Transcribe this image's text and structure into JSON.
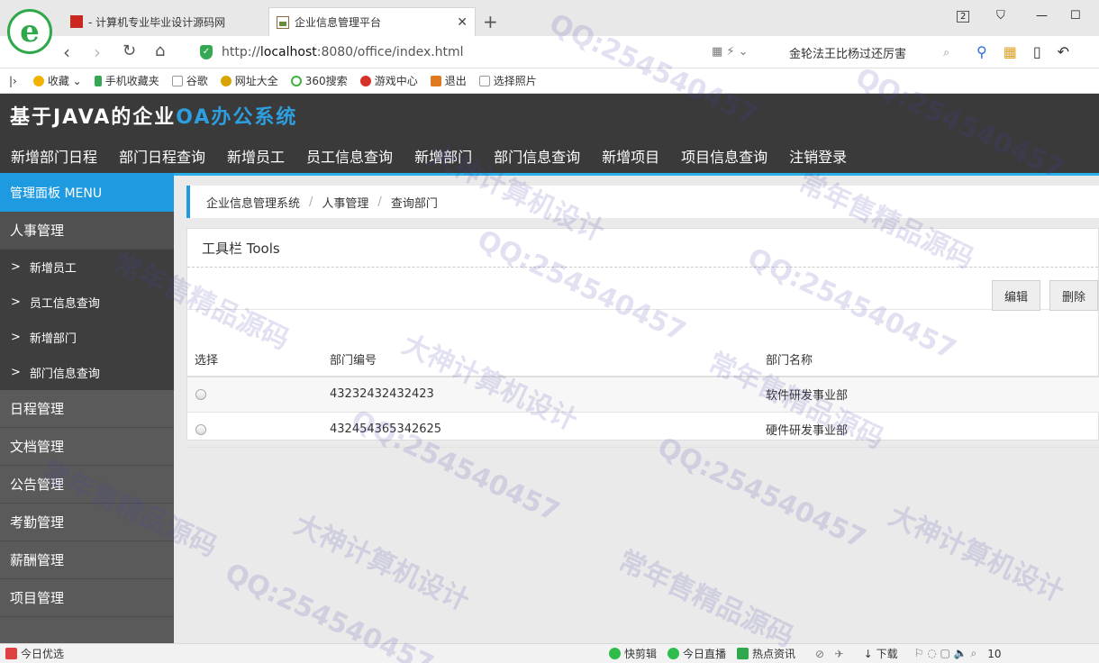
{
  "browser": {
    "tabs": [
      {
        "title": "- 计算机专业毕业设计源码网"
      },
      {
        "title": "企业信息管理平台"
      }
    ],
    "url_prefix": "http://",
    "url_host": "localhost",
    "url_rest": ":8080/office/index.html",
    "search_text": "金轮法王比杨过还厉害",
    "tab_count": "2",
    "favorites": [
      "收藏",
      "手机收藏夹",
      "谷歌",
      "网址大全",
      "360搜索",
      "游戏中心",
      "退出",
      "选择照片"
    ],
    "status": {
      "left": "今日优选",
      "items": [
        "快剪辑",
        "今日直播",
        "热点资讯",
        "下载"
      ],
      "zoom": "10"
    }
  },
  "app": {
    "logo_main": "基于JAVA的企业",
    "logo_accent": "OA办公系统",
    "topnav": [
      "新增部门日程",
      "部门日程查询",
      "新增员工",
      "员工信息查询",
      "新增部门",
      "部门信息查询",
      "新增项目",
      "项目信息查询",
      "注销登录"
    ]
  },
  "sidebar": {
    "header": "管理面板 MENU",
    "groups": [
      {
        "label": "人事管理",
        "open": true,
        "items": [
          "新增员工",
          "员工信息查询",
          "新增部门",
          "部门信息查询"
        ]
      },
      {
        "label": "日程管理"
      },
      {
        "label": "文档管理"
      },
      {
        "label": "公告管理"
      },
      {
        "label": "考勤管理"
      },
      {
        "label": "薪酬管理"
      },
      {
        "label": "项目管理"
      }
    ]
  },
  "breadcrumb": [
    "企业信息管理系统",
    "人事管理",
    "查询部门"
  ],
  "panel": {
    "title": "工具栏 Tools",
    "edit_label": "编辑",
    "delete_label": "删除"
  },
  "table": {
    "headers": [
      "选择",
      "部门编号",
      "部门名称"
    ],
    "rows": [
      {
        "id": "43232432432423",
        "name": "软件研发事业部"
      },
      {
        "id": "432454365342625",
        "name": "硬件研发事业部"
      }
    ]
  },
  "watermarks": [
    "QQ:254540457",
    "大神计算机设计",
    "常年售精品源码"
  ]
}
